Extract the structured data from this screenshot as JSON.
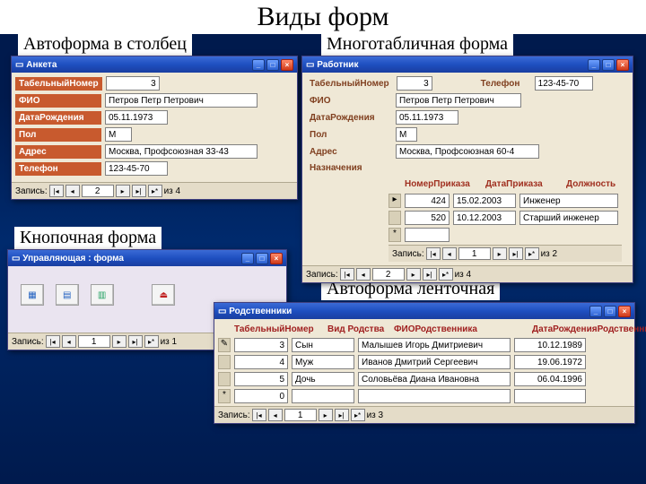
{
  "slide": {
    "title": "Виды форм"
  },
  "captions": {
    "columnar": "Автоформа в столбец",
    "multitable": "Многотабличная форма",
    "switchboard": "Кнопочная форма",
    "datasheet": "Автоформа ленточная"
  },
  "anketa": {
    "title": "Анкета",
    "labels": {
      "tabno": "ТабельныйНомер",
      "fio": "ФИО",
      "dob": "ДатаРождения",
      "sex": "Пол",
      "addr": "Адрес",
      "phone": "Телефон"
    },
    "values": {
      "tabno": "3",
      "fio": "Петров Петр Петрович",
      "dob": "05.11.1973",
      "sex": "М",
      "addr": "Москва, Профсоюзная 33-43",
      "phone": "123-45-70"
    },
    "nav": {
      "label": "Запись:",
      "pos": "2",
      "of": "из 4"
    }
  },
  "rabotnik": {
    "title": "Работник",
    "labels": {
      "tabno": "ТабельныйНомер",
      "fio": "ФИО",
      "dob": "ДатаРождения",
      "sex": "Пол",
      "addr": "Адрес",
      "phone": "Телефон",
      "assign": "Назначения"
    },
    "values": {
      "tabno": "3",
      "fio": "Петров Петр Петрович",
      "dob": "05.11.1973",
      "sex": "М",
      "addr": "Москва, Профсоюзная 60-4",
      "phone": "123-45-70"
    },
    "sub": {
      "headers": {
        "no": "НомерПриказа",
        "date": "ДатаПриказа",
        "pos": "Должность"
      },
      "rows": [
        {
          "no": "424",
          "date": "15.02.2003",
          "pos": "Инженер"
        },
        {
          "no": "520",
          "date": "10.12.2003",
          "pos": "Старший инженер"
        }
      ],
      "nav": {
        "label": "Запись:",
        "pos": "1",
        "of": "из 2"
      }
    },
    "nav": {
      "label": "Запись:",
      "pos": "2",
      "of": "из 4"
    }
  },
  "switchboard": {
    "title": "Управляющая : форма",
    "nav": {
      "label": "Запись:",
      "pos": "1",
      "of": "из 1"
    }
  },
  "relatives": {
    "title": "Родственники",
    "headers": {
      "tabno": "ТабельныйНомер",
      "rel": "Вид Родства",
      "fio": "ФИОРодственника",
      "dob": "ДатаРожденияРодственника"
    },
    "rows": [
      {
        "tabno": "3",
        "rel": "Сын",
        "fio": "Малышев Игорь Дмитриевич",
        "dob": "10.12.1989"
      },
      {
        "tabno": "4",
        "rel": "Муж",
        "fio": "Иванов Дмитрий Сергеевич",
        "dob": "19.06.1972"
      },
      {
        "tabno": "5",
        "rel": "Дочь",
        "fio": "Соловьёва Диана Ивановна",
        "dob": "06.04.1996"
      },
      {
        "tabno": "0",
        "rel": "",
        "fio": "",
        "dob": ""
      }
    ],
    "nav": {
      "label": "Запись:",
      "pos": "1",
      "of": "из 3"
    }
  }
}
